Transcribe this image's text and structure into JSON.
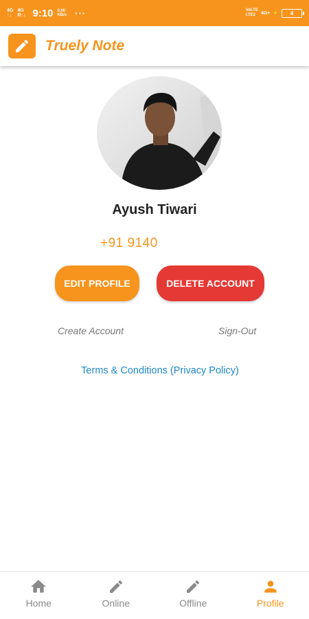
{
  "status_bar": {
    "sim1_top": "4G",
    "sim1_bottom": "↑↓",
    "sim2_top": "4G",
    "sim2_bottom": "R↑↓",
    "time": "9:10",
    "speed_value": "0.00",
    "speed_unit": "KB/s",
    "more": "···",
    "volte_top": "VoLTE",
    "volte_bottom": "LTE2",
    "network": "4G+",
    "battery_level": "4"
  },
  "app_bar": {
    "title": "Truely Note",
    "logo_icon": "pencil-icon"
  },
  "profile": {
    "name": "Ayush Tiwari",
    "phone": "+91 9140"
  },
  "actions": {
    "edit_label": "EDIT PROFILE",
    "delete_label": "DELETE ACCOUNT",
    "create_account": "Create Account",
    "sign_out": "Sign-Out",
    "terms": "Terms & Conditions (Privacy Policy)"
  },
  "bottom_nav": {
    "items": [
      {
        "label": "Home",
        "icon": "home-icon"
      },
      {
        "label": "Online",
        "icon": "pencil-icon"
      },
      {
        "label": "Offline",
        "icon": "pencil-icon"
      },
      {
        "label": "Profile",
        "icon": "person-icon"
      }
    ],
    "active": "Profile"
  },
  "colors": {
    "accent": "#f7941d",
    "danger": "#e53935",
    "link": "#1e88c8",
    "inactive": "#8a8a8a"
  }
}
